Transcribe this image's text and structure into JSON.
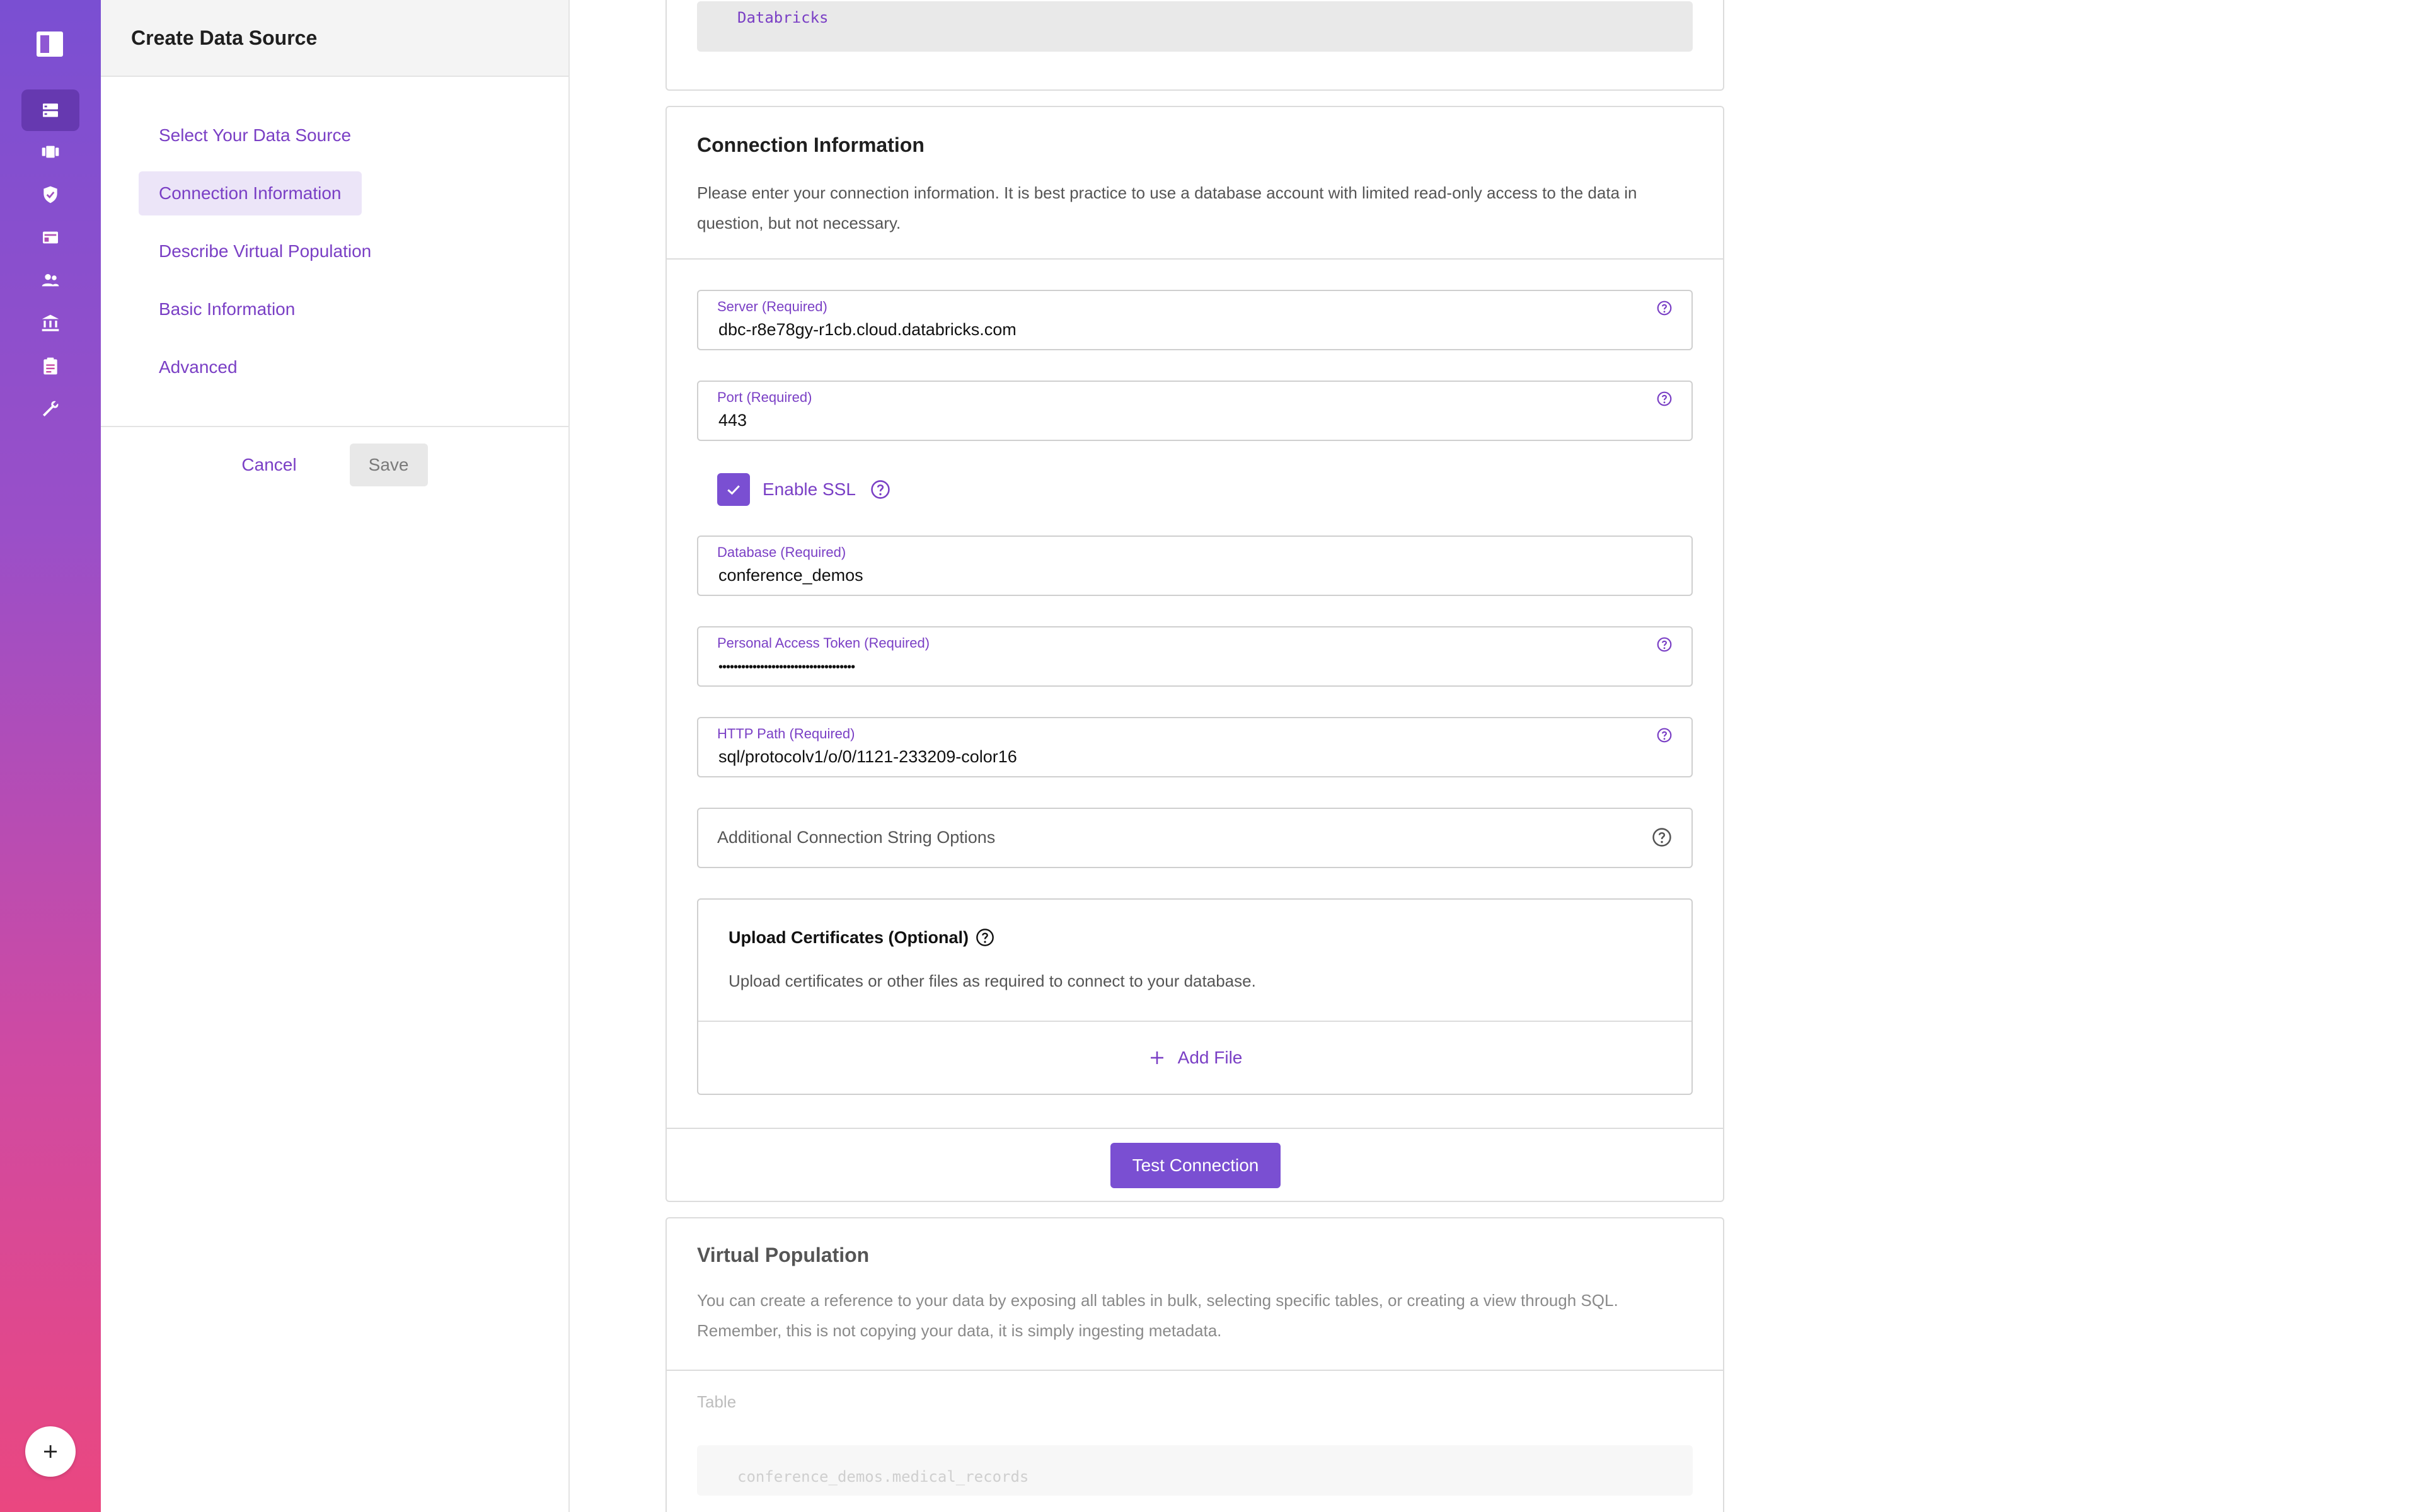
{
  "sidebar": {
    "nav_icons": [
      "panel-logo-icon",
      "data-sources-icon",
      "projects-icon",
      "policies-icon",
      "catalog-icon",
      "users-icon",
      "governance-icon",
      "audit-icon",
      "tools-icon",
      "add-icon"
    ]
  },
  "panel": {
    "title": "Create Data Source",
    "steps": [
      {
        "label": "Select Your Data Source",
        "current": false
      },
      {
        "label": "Connection Information",
        "current": true
      },
      {
        "label": "Describe Virtual Population",
        "current": false
      },
      {
        "label": "Basic Information",
        "current": false
      },
      {
        "label": "Advanced",
        "current": false
      }
    ],
    "cancel_label": "Cancel",
    "save_label": "Save"
  },
  "top_card": {
    "code_value": "Databricks"
  },
  "connection": {
    "heading": "Connection Information",
    "description": "Please enter your connection information. It is best practice to use a database account with limited read-only access to the data in question, but not necessary.",
    "server": {
      "label": "Server (Required)",
      "value": "dbc-r8e78gy-r1cb.cloud.databricks.com"
    },
    "port": {
      "label": "Port (Required)",
      "value": "443"
    },
    "ssl": {
      "label": "Enable SSL",
      "checked": true
    },
    "database": {
      "label": "Database (Required)",
      "value": "conference_demos"
    },
    "token": {
      "label": "Personal Access Token (Required)",
      "value": "••••••••••••••••••••••••••••••••••••"
    },
    "http_path": {
      "label": "HTTP Path (Required)",
      "value": "sql/protocolv1/o/0/1121-233209-color16"
    },
    "extra_options": {
      "placeholder": "Additional Connection String Options"
    },
    "upload": {
      "title": "Upload Certificates (Optional)",
      "description": "Upload certificates or other files as required to connect to your database.",
      "add_label": "Add File"
    },
    "test_label": "Test Connection"
  },
  "virtual_population": {
    "heading": "Virtual Population",
    "description": "You can create a reference to your data by exposing all tables in bulk, selecting specific tables, or creating a view through SQL. Remember, this is not copying your data, it is simply ingesting metadata.",
    "table_label": "Table",
    "table_value": "conference_demos.medical_records"
  },
  "colors": {
    "accent": "#7a4fd2",
    "accent_text": "#7a3fc5",
    "rail_top": "#7a4fd2",
    "rail_bottom": "#ea4780"
  }
}
